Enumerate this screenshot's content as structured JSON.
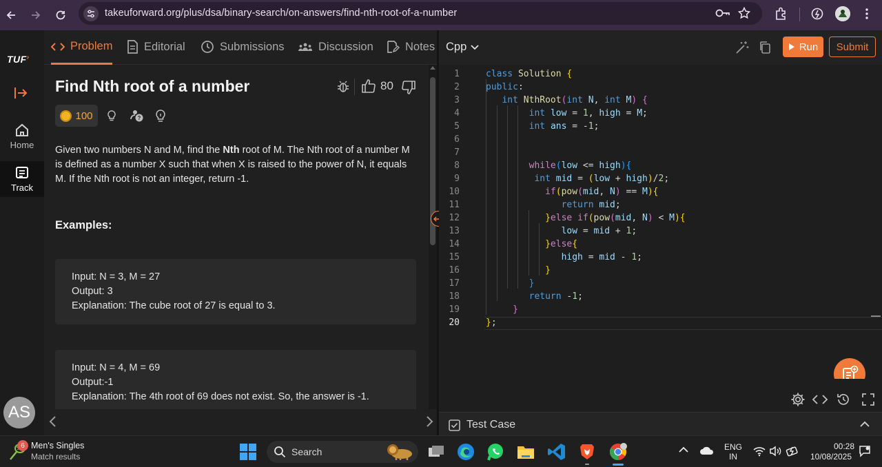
{
  "browser": {
    "url": "takeuforward.org/plus/dsa/binary-search/on-answers/find-nth-root-of-a-number"
  },
  "rail": {
    "logo": "TUF",
    "home_label": "Home",
    "track_label": "Track",
    "avatar_initials": "AS"
  },
  "tabs": [
    {
      "label": "Problem",
      "active": true
    },
    {
      "label": "Editorial"
    },
    {
      "label": "Submissions"
    },
    {
      "label": "Discussion"
    },
    {
      "label": "Notes"
    }
  ],
  "problem": {
    "title": "Find Nth root of a number",
    "likes": "80",
    "coins": "100",
    "desc_part1": "Given two numbers N and M, find the ",
    "desc_bold": "Nth",
    "desc_part2": " root of M. The Nth root of a number M is defined as a number X such that when X is raised to the power of N, it equals M. If the Nth root is not an integer, return -1.",
    "examples_heading": "Examples:",
    "examples": [
      {
        "input": "Input: N = 3, M = 27",
        "output": "Output: 3",
        "explanation": "Explanation: The cube root of 27 is equal to 3."
      },
      {
        "input": "Input: N = 4, M = 69",
        "output": "Output:-1",
        "explanation": "Explanation: The 4th root of 69 does not exist. So, the answer is -1."
      }
    ]
  },
  "editor": {
    "language": "Cpp",
    "run_label": "Run",
    "submit_label": "Submit",
    "testcase_label": "Test Case",
    "line_numbers": [
      "1",
      "2",
      "3",
      "4",
      "5",
      "6",
      "7",
      "8",
      "9",
      "10",
      "11",
      "12",
      "13",
      "14",
      "15",
      "16",
      "17",
      "18",
      "19",
      "20"
    ],
    "code": [
      "class Solution {",
      "public:",
      "   int NthRoot(int N, int M) {",
      "        int low = 1, high = M;",
      "        int ans = -1;",
      "",
      "",
      "        while(low <= high){",
      "         int mid = (low + high)/2;",
      "           if(pow(mid, N) == M){",
      "              return mid;",
      "           }else if(pow(mid, N) < M){",
      "              low = mid + 1;",
      "           }else{",
      "              high = mid - 1;",
      "           }",
      "        }",
      "        return -1;",
      "     }",
      "};"
    ]
  },
  "taskbar": {
    "notification_badge": "6",
    "news_title": "Men's Singles",
    "news_sub": "Match results",
    "search_label": "Search",
    "lang_line1": "ENG",
    "lang_line2": "IN",
    "time": "00:28",
    "date": "10/08/2025"
  },
  "colors": {
    "accent": "#f07a3a",
    "chrome_bg": "#3b2b44",
    "panel_bg": "#202020",
    "editor_bg": "#1e1e1e"
  }
}
